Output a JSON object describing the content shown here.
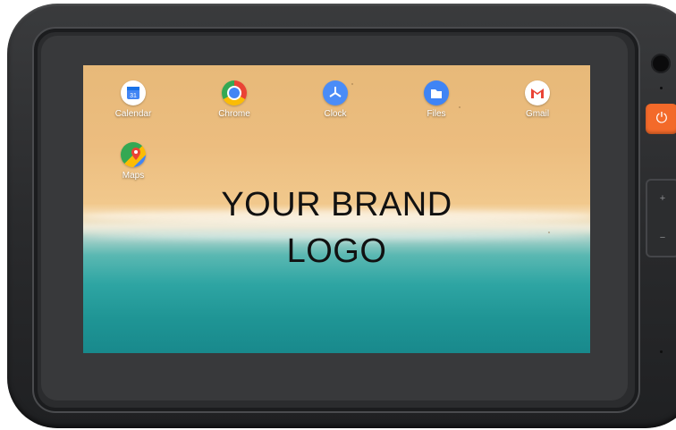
{
  "device": {
    "brand_logo_lines": [
      "YOUR BRAND",
      "LOGO"
    ],
    "colors": {
      "power_button": "#f36a2a",
      "shell": "#2a2b2d"
    }
  },
  "apps": [
    {
      "label": "Calendar",
      "icon": "calendar-icon",
      "badge": "31",
      "color": "#4285f4"
    },
    {
      "label": "Chrome",
      "icon": "chrome-icon",
      "color": "#ea4335"
    },
    {
      "label": "Clock",
      "icon": "clock-icon",
      "color": "#4a8cf7"
    },
    {
      "label": "Files",
      "icon": "files-icon",
      "color": "#3f84f5"
    },
    {
      "label": "Gmail",
      "icon": "gmail-icon",
      "color": "#ffffff"
    },
    {
      "label": "Maps",
      "icon": "maps-icon",
      "color": "#34a853"
    }
  ],
  "hardware": {
    "power_symbol": "⏻",
    "volume_plus": "+",
    "volume_minus": "−"
  }
}
